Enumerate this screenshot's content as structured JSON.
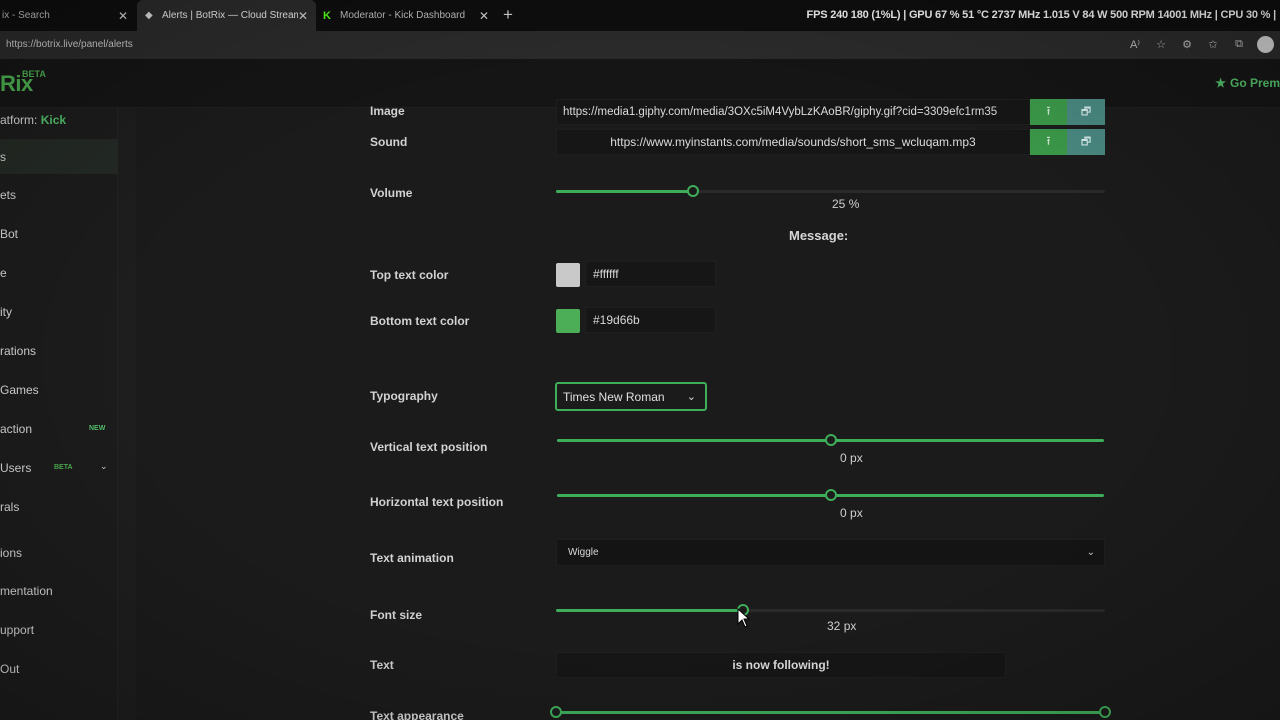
{
  "browser": {
    "tabs": [
      {
        "title": "ix - Search",
        "close": "✕"
      },
      {
        "title": "Alerts | BotRix — Cloud Streaming",
        "close": "✕"
      },
      {
        "title": "Moderator - Kick Dashboard",
        "close": "✕"
      }
    ],
    "new_tab": "+",
    "hud": "FPS 240  180 (1%L)  |  GPU 67 %  51 °C  2737 MHz  1.015 V  84 W  500 RPM  14001 MHz  |  CPU 30 %  |",
    "url": "https://botrix.live/panel/alerts"
  },
  "app": {
    "logo": "Rix",
    "logo_beta": "BETA",
    "go_premium": "Go Prem"
  },
  "sidebar": {
    "platform_label": "atform:",
    "platform_value": "Kick",
    "items": [
      {
        "label": "s"
      },
      {
        "label": "ets"
      },
      {
        "label": "Bot"
      },
      {
        "label": "e"
      },
      {
        "label": "ity"
      },
      {
        "label": "rations"
      },
      {
        "label": "Games"
      },
      {
        "label": "action",
        "badge": "NEW"
      },
      {
        "label": "Users",
        "badge": "BETA",
        "chevron": "⌄"
      },
      {
        "label": "rals"
      },
      {
        "label": "ions"
      },
      {
        "label": "mentation"
      },
      {
        "label": "upport"
      },
      {
        "label": "Out"
      }
    ]
  },
  "form": {
    "image": {
      "label": "Image",
      "value": "https://media1.giphy.com/media/3OXc5iM4VybLzKAoBR/giphy.gif?cid=3309efc1rm35"
    },
    "sound": {
      "label": "Sound",
      "value": "https://www.myinstants.com/media/sounds/short_sms_wcluqam.mp3"
    },
    "volume": {
      "label": "Volume",
      "value": "25",
      "unit": "%",
      "fraction": 0.25
    },
    "message_heading": "Message:",
    "top_text_color": {
      "label": "Top text color",
      "value": "#ffffff",
      "swatch": "#c9c9c9"
    },
    "bottom_text_color": {
      "label": "Bottom text color",
      "value": "#19d66b",
      "swatch": "#4caf58"
    },
    "typography": {
      "label": "Typography",
      "value": "Times New Roman"
    },
    "vertical_position": {
      "label": "Vertical text position",
      "value": "0",
      "unit": "px",
      "fraction": 0.5
    },
    "horizontal_position": {
      "label": "Horizontal text position",
      "value": "0",
      "unit": "px",
      "fraction": 0.5
    },
    "text_animation": {
      "label": "Text animation",
      "value": "Wiggle"
    },
    "font_size": {
      "label": "Font size",
      "value": "32",
      "unit": "px",
      "fraction": 0.34
    },
    "text": {
      "label": "Text",
      "value": "is now following!"
    },
    "text_appearance": {
      "label": "Text appearance"
    }
  },
  "colors": {
    "accent": "#3fae5a",
    "kick": "#53fc18"
  }
}
